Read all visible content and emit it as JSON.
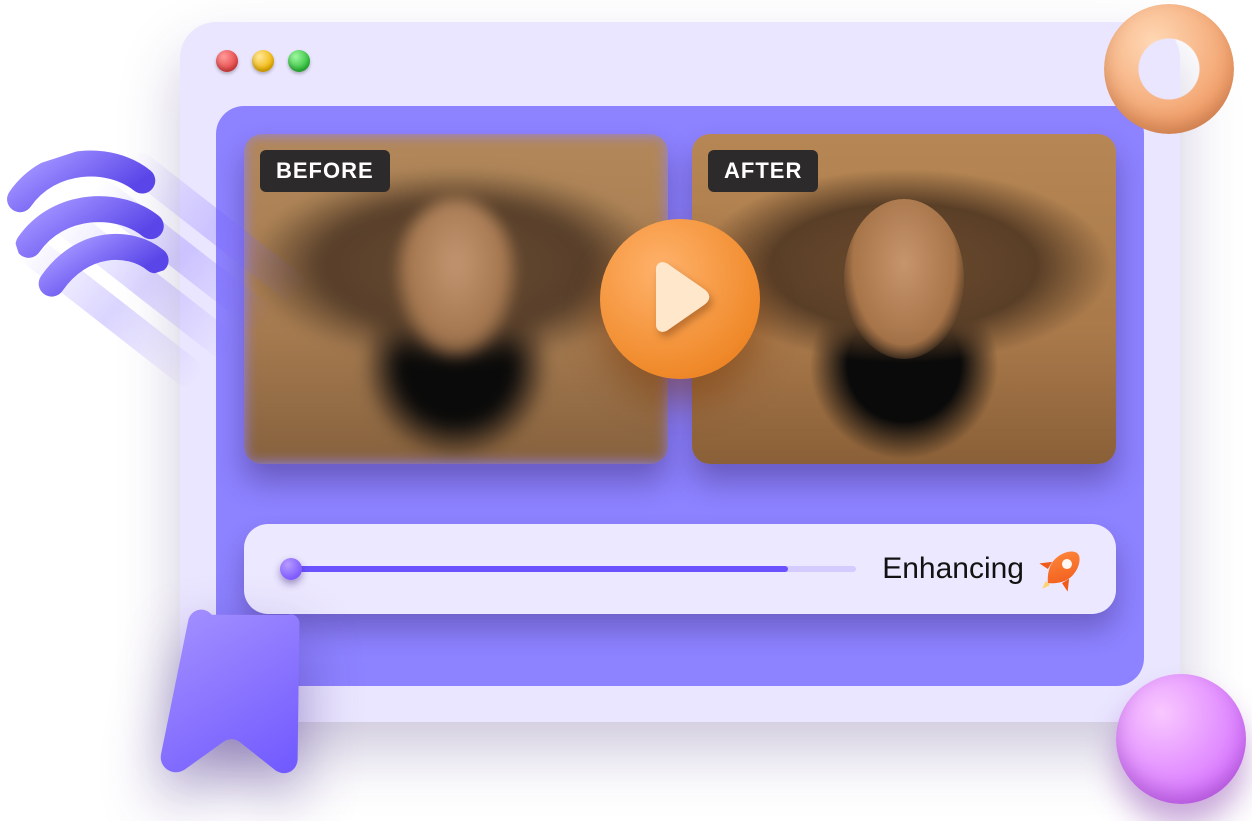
{
  "labels": {
    "before": "BEFORE",
    "after": "AFTER"
  },
  "progress": {
    "status": "Enhancing",
    "percent": 88
  },
  "icons": {
    "play": "play-icon",
    "rocket": "rocket-icon",
    "donut": "donut-icon",
    "sphere": "sphere-icon",
    "cursor": "cursor-icon",
    "spring": "spring-icon",
    "close": "close-dot-icon",
    "minimize": "minimize-dot-icon",
    "maximize": "maximize-dot-icon"
  },
  "colors": {
    "window_bg": "#EAE6FF",
    "panel_bg": "#8D82FF",
    "accent_purple": "#6A52FF",
    "accent_orange": "#F08A2B",
    "badge_bg": "#2C2A2A"
  }
}
